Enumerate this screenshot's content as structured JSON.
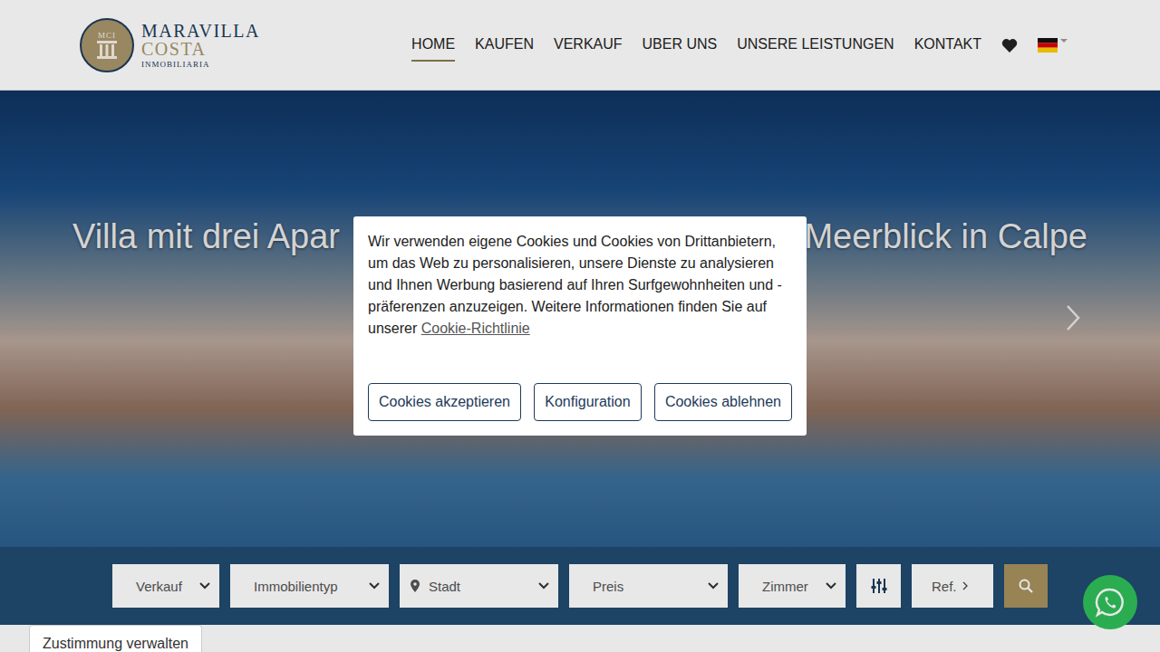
{
  "header": {
    "logo": {
      "monogram": "MCI",
      "line1": "MARAVILLA",
      "line2": "COSTA",
      "line3": "INMOBILIARIA"
    },
    "nav": [
      {
        "label": "HOME",
        "selected": true
      },
      {
        "label": "KAUFEN",
        "selected": false
      },
      {
        "label": "VERKAUF",
        "selected": false
      },
      {
        "label": "UBER UNS",
        "selected": false
      },
      {
        "label": "UNSERE LEISTUNGEN",
        "selected": false
      },
      {
        "label": "KONTAKT",
        "selected": false
      }
    ]
  },
  "hero": {
    "heading_parts": [
      "Villa mit drei Apar",
      "Meerblick in Calpe"
    ]
  },
  "search": {
    "fields": [
      {
        "kind": "select",
        "label": "Verkauf"
      },
      {
        "kind": "select",
        "label": "Immobilientyp"
      },
      {
        "kind": "location",
        "label": "Stadt"
      },
      {
        "kind": "select",
        "label": "Preis"
      },
      {
        "kind": "select",
        "label": "Zimmer"
      },
      {
        "kind": "filter"
      },
      {
        "kind": "ref",
        "label": "Ref."
      },
      {
        "kind": "search"
      }
    ]
  },
  "cookie_dialog": {
    "text": "Wir verwenden eigene Cookies und Cookies von Drittanbietern, um das Web zu personalisieren, unsere Dienste zu analysieren und Ihnen Werbung basierend auf Ihren Surfgewohnheiten und -präferenzen anzuzeigen. Weitere Informationen finden Sie auf unserer ",
    "link": "Cookie-Richtlinie",
    "buttons": [
      "Cookies akzeptieren",
      "Konfiguration",
      "Cookies ablehnen"
    ]
  },
  "consent_tab": "Zustimmung verwalten"
}
